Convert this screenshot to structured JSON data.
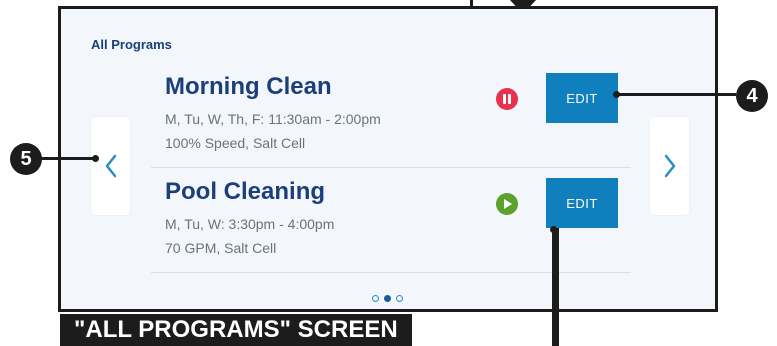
{
  "screen": {
    "title": "All Programs",
    "nav": {
      "prev_icon": "chevron-left-icon",
      "next_icon": "chevron-right-icon"
    },
    "programs": [
      {
        "name": "Morning Clean",
        "schedule": "M, Tu, W, Th, F: 11:30am - 2:00pm",
        "settings": "100% Speed, Salt Cell",
        "status_icon": "pause-icon",
        "edit_label": "EDIT"
      },
      {
        "name": "Pool Cleaning",
        "schedule": "M, Tu, W: 3:30pm - 4:00pm",
        "settings": "70 GPM, Salt Cell",
        "status_icon": "play-icon",
        "edit_label": "EDIT"
      }
    ],
    "pager": {
      "pages": 3,
      "current": 2
    }
  },
  "callouts": {
    "four": "4",
    "five": "5"
  },
  "caption": "\"ALL PROGRAMS\" SCREEN",
  "colors": {
    "accent": "#0f7fbd",
    "title": "#1c3f7a",
    "pause": "#e8334f",
    "play": "#5aa22d"
  }
}
